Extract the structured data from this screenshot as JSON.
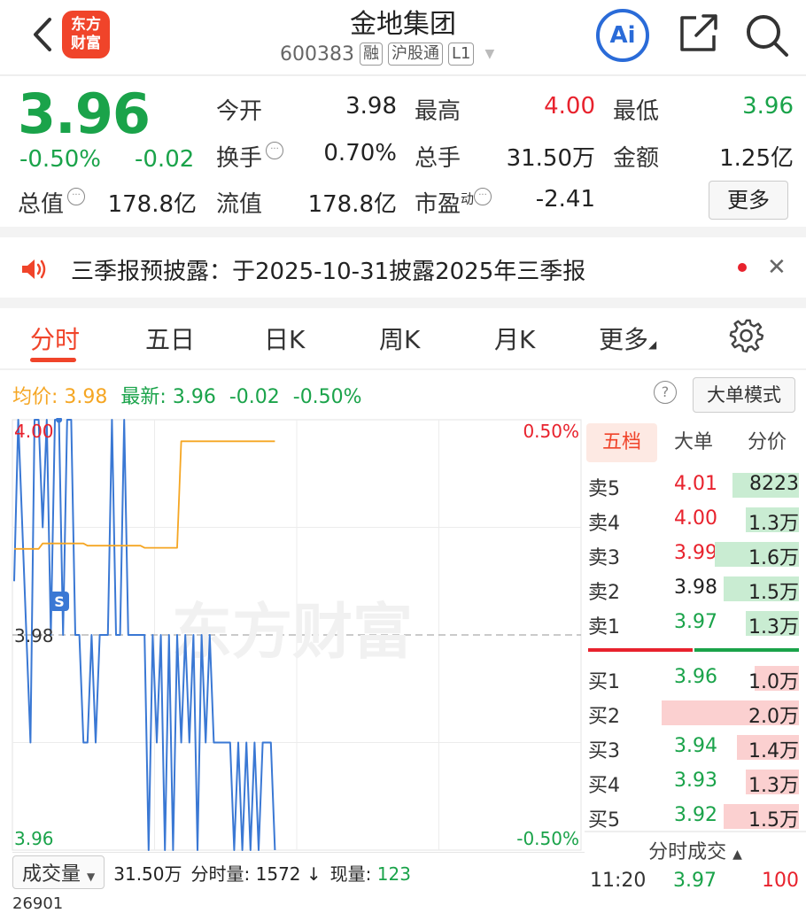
{
  "header": {
    "logo_line1": "东方",
    "logo_line2": "财富",
    "title": "金地集团",
    "code": "600383",
    "tags": [
      "融",
      "沪股通",
      "L1"
    ],
    "ai_label": "Ai"
  },
  "quote": {
    "price": "3.96",
    "change_pct": "-0.50%",
    "change": "-0.02",
    "fields": [
      {
        "label": "今开",
        "value": "3.98",
        "color": "#222222"
      },
      {
        "label": "最高",
        "value": "4.00",
        "color": "#e8222d"
      },
      {
        "label": "最低",
        "value": "3.96",
        "color": "#1aa34a"
      },
      {
        "label": "换手",
        "value": "0.70%",
        "color": "#222222"
      },
      {
        "label": "总手",
        "value": "31.50万",
        "color": "#222222"
      },
      {
        "label": "金额",
        "value": "1.25亿",
        "color": "#222222"
      },
      {
        "label": "总值",
        "value": "178.8亿",
        "color": "#222222"
      },
      {
        "label": "流值",
        "value": "178.8亿",
        "color": "#222222"
      },
      {
        "label": "市盈",
        "sup": "动",
        "value": "-2.41",
        "color": "#222222"
      }
    ],
    "more_label": "更多"
  },
  "notice": {
    "text": "三季报预披露：于2025-10-31披露2025年三季报",
    "close": "✕"
  },
  "tabs": [
    "分时",
    "五日",
    "日K",
    "周K",
    "月K",
    "更多"
  ],
  "avg_row": {
    "avg_label": "均价:",
    "avg_value": "3.98",
    "latest_label": "最新:",
    "latest_value": "3.96",
    "latest_change": "-0.02",
    "latest_pct": "-0.50%",
    "help": "?",
    "big_mode": "大单模式"
  },
  "chart_data": {
    "type": "line",
    "y_left_ticks": [
      "4.00",
      "3.98",
      "3.96"
    ],
    "y_right_ticks": [
      "0.50%",
      "-0.50%"
    ],
    "ylim": [
      3.96,
      4.0
    ],
    "ref_price": 3.98,
    "series": [
      {
        "name": "最新",
        "color": "#3a78d4",
        "values": [
          3.985,
          4.0,
          3.99,
          3.98,
          3.97,
          4.0,
          4.0,
          3.99,
          4.0,
          3.98,
          4.0,
          4.0,
          3.98,
          4.0,
          4.0,
          3.98,
          3.98,
          3.97,
          3.97,
          3.98,
          3.97,
          3.98,
          3.98,
          3.98,
          4.0,
          3.98,
          3.98,
          4.0,
          3.98,
          3.98,
          3.98,
          3.98,
          3.98,
          3.96,
          3.98,
          3.97,
          3.98,
          3.96,
          3.98,
          3.96,
          3.98,
          3.97,
          3.98,
          3.97,
          3.98,
          3.96,
          3.98,
          3.97,
          3.98,
          3.97,
          3.97,
          3.97,
          3.97,
          3.97,
          3.96,
          3.97,
          3.96,
          3.97,
          3.96,
          3.97,
          3.96,
          3.97,
          3.97,
          3.97,
          3.96
        ]
      },
      {
        "name": "均价",
        "color": "#f5a623",
        "values": [
          3.988,
          3.988,
          3.988,
          3.988,
          3.988,
          3.988,
          3.988,
          3.9885,
          3.9885,
          3.9885,
          3.9885,
          3.9885,
          3.9885,
          3.9885,
          3.9885,
          3.9885,
          3.9885,
          3.9885,
          3.9883,
          3.9883,
          3.9883,
          3.9883,
          3.9883,
          3.9883,
          3.9883,
          3.9883,
          3.9883,
          3.9883,
          3.9883,
          3.9883,
          3.9883,
          3.9883,
          3.9881,
          3.9881,
          3.9881,
          3.9881,
          3.9881,
          3.9881,
          3.9881,
          3.9881,
          3.9881,
          3.998,
          3.998,
          3.998,
          3.998,
          3.998,
          3.998,
          3.998,
          3.998,
          3.998,
          3.998,
          3.998,
          3.998,
          3.998,
          3.998,
          3.998,
          3.998,
          3.998,
          3.998,
          3.998,
          3.998,
          3.998,
          3.998,
          3.998,
          3.998
        ]
      }
    ]
  },
  "order_book": {
    "tabs": [
      "五档",
      "大单",
      "分价"
    ],
    "asks": [
      {
        "label": "卖5",
        "price": "4.01",
        "vol": "8223",
        "ratio": 0.3,
        "price_color": "#e8222d"
      },
      {
        "label": "卖4",
        "price": "4.00",
        "vol": "1.3万",
        "ratio": 0.24,
        "price_color": "#e8222d"
      },
      {
        "label": "卖3",
        "price": "3.99",
        "vol": "1.6万",
        "ratio": 0.38,
        "price_color": "#e8222d"
      },
      {
        "label": "卖2",
        "price": "3.98",
        "vol": "1.5万",
        "ratio": 0.34,
        "price_color": "#222222"
      },
      {
        "label": "卖1",
        "price": "3.97",
        "vol": "1.3万",
        "ratio": 0.24,
        "price_color": "#1aa34a"
      }
    ],
    "bids": [
      {
        "label": "买1",
        "price": "3.96",
        "vol": "1.0万",
        "ratio": 0.2,
        "price_color": "#1aa34a"
      },
      {
        "label": "买2",
        "price": "3.95",
        "vol": "2.0万",
        "ratio": 0.62,
        "price_color": "#1aa34a"
      },
      {
        "label": "买3",
        "price": "3.94",
        "vol": "1.4万",
        "ratio": 0.28,
        "price_color": "#1aa34a"
      },
      {
        "label": "买4",
        "price": "3.93",
        "vol": "1.3万",
        "ratio": 0.24,
        "price_color": "#1aa34a"
      },
      {
        "label": "买5",
        "price": "3.92",
        "vol": "1.5万",
        "ratio": 0.34,
        "price_color": "#1aa34a"
      }
    ]
  },
  "trades": {
    "header": "分时成交",
    "rows": [
      {
        "time": "11:20",
        "price": "3.97",
        "vol": "100"
      }
    ]
  },
  "volume": {
    "selector": "成交量",
    "total": "31.50万",
    "fen_label": "分时量:",
    "fen_value": "1572",
    "now_label": "现量:",
    "now_value": "123",
    "tick": "26901"
  },
  "watermark": "东方财富",
  "marker": "S"
}
